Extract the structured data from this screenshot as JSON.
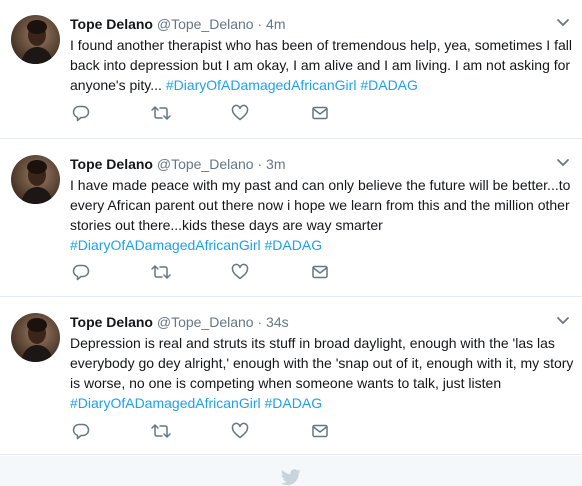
{
  "tweets": [
    {
      "name": "Tope Delano",
      "handle": "@Tope_Delano",
      "separator": "·",
      "time": "4m",
      "text": "I found another therapist who has been of tremendous help, yea, sometimes I fall back into depression but I am okay, I am alive and I am living. I am not asking for anyone's pity...",
      "hashtags": [
        "#DiaryOfADamagedAfricanGirl",
        "#DADAG"
      ]
    },
    {
      "name": "Tope Delano",
      "handle": "@Tope_Delano",
      "separator": "·",
      "time": "3m",
      "text": "I have made peace with my past and can only believe the future will be better...to every African parent out there now i hope we learn from this and the million other stories out there...kids these days are way smarter",
      "hashtags": [
        "#DiaryOfADamagedAfricanGirl",
        "#DADAG"
      ]
    },
    {
      "name": "Tope Delano",
      "handle": "@Tope_Delano",
      "separator": "·",
      "time": "34s",
      "text": "Depression is real and struts its stuff in broad daylight, enough with the 'las las everybody go dey alright,' enough with the 'snap out of it, enough with it, my story is worse, no one is competing when someone wants to talk, just listen",
      "hashtags": [
        "#DiaryOfADamagedAfricanGirl",
        "#DADAG"
      ]
    }
  ],
  "icons": {
    "reply": "reply-icon",
    "retweet": "retweet-icon",
    "like": "heart-icon",
    "dm": "envelope-icon",
    "menu": "chevron-down-icon",
    "footer": "twitter-bird-icon"
  },
  "colors": {
    "hashtag": "#1da1f2",
    "icon": "#657786",
    "divider": "#e6ecf0",
    "footer_bg": "#f5f8fa"
  }
}
